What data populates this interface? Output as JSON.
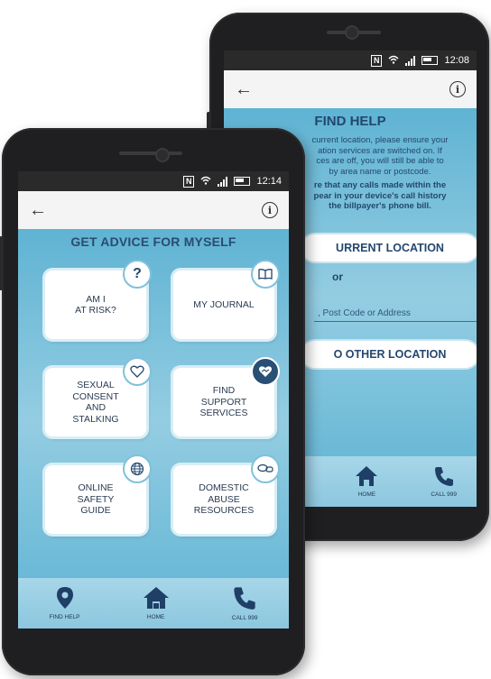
{
  "back_phone": {
    "status": {
      "time": "12:08",
      "nfc": "N"
    },
    "title": "FIND HELP",
    "body_lines": [
      "current location, please ensure your",
      "ation services are switched on. If",
      "ces are off, you will still be able to",
      "by area name or postcode."
    ],
    "bold_lines": [
      "re that any calls made within the",
      "pear in your device's call history",
      "the billpayer's phone bill."
    ],
    "current_location_button": "URRENT LOCATION",
    "or_text": "or",
    "search_placeholder": ", Post Code or Address",
    "other_location_button": "O OTHER LOCATION",
    "nav": {
      "home": "HOME",
      "call": "CALL 999"
    }
  },
  "front_phone": {
    "status": {
      "time": "12:14",
      "nfc": "N"
    },
    "title": "GET ADVICE FOR MYSELF",
    "tiles": [
      {
        "label": "AM I\nAT RISK?",
        "icon": "question-icon"
      },
      {
        "label": "MY JOURNAL",
        "icon": "book-icon"
      },
      {
        "label": "SEXUAL\nCONSENT\nAND\nSTALKING",
        "icon": "heart-icon"
      },
      {
        "label": "FIND\nSUPPORT\nSERVICES",
        "icon": "handshake-heart-icon"
      },
      {
        "label": "ONLINE\nSAFETY\nGUIDE",
        "icon": "globe-icon"
      },
      {
        "label": "DOMESTIC\nABUSE\nRESOURCES",
        "icon": "chat-bubbles-icon"
      }
    ],
    "question_glyph": "?",
    "nav": {
      "find_help": "FIND HELP",
      "home": "HOME",
      "call": "CALL 999"
    }
  },
  "colors": {
    "accent_dark": "#23476e",
    "screen_blue": "#5fb3d3"
  }
}
